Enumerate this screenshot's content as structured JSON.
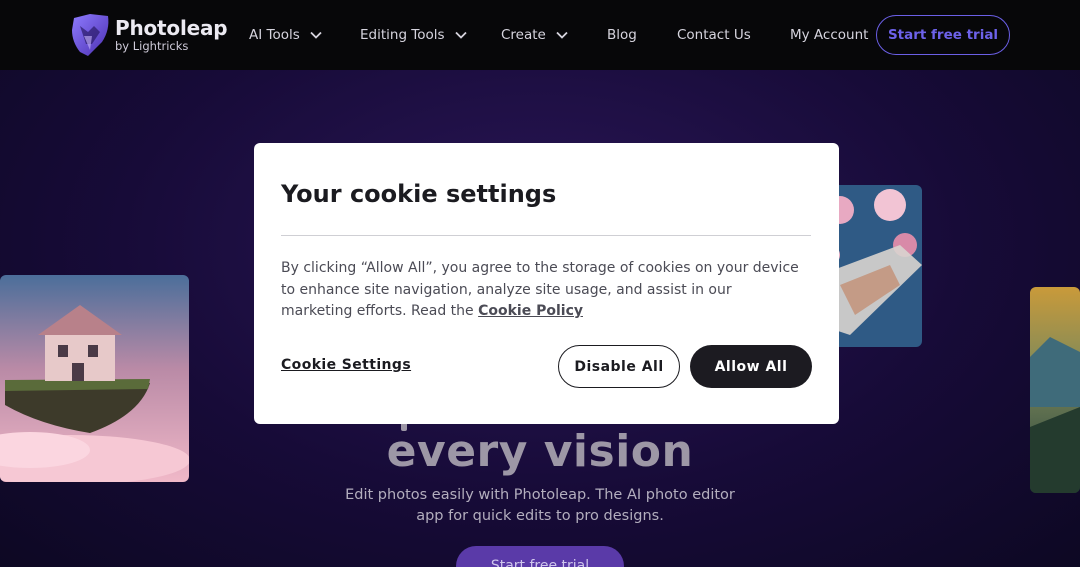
{
  "brand": {
    "name": "Photoleap",
    "sub": "by Lightricks",
    "logo_icon": "photoleap-logo-icon",
    "accent": "#6b5fe6"
  },
  "nav": {
    "items": [
      {
        "label": "AI Tools",
        "has_dropdown": true
      },
      {
        "label": "Editing Tools",
        "has_dropdown": true
      },
      {
        "label": "Create",
        "has_dropdown": true
      },
      {
        "label": "Blog",
        "has_dropdown": false
      },
      {
        "label": "Contact Us",
        "has_dropdown": false
      },
      {
        "label": "My Account",
        "has_dropdown": false
      }
    ],
    "cta_label": "Start free trial"
  },
  "hero": {
    "title_line2": "every vision",
    "subtitle": "Edit photos easily with Photoleap. The AI photo editor app for quick edits to pro designs."
  },
  "cookie_dialog": {
    "title": "Your cookie settings",
    "body": "By clicking “Allow All”, you agree to the storage of cookies on your device to enhance site navigation, analyze site usage, and assist in our marketing efforts. Read the ",
    "policy_link": "Cookie Policy",
    "settings_link": "Cookie Settings",
    "disable_label": "Disable All",
    "allow_label": "Allow All"
  }
}
